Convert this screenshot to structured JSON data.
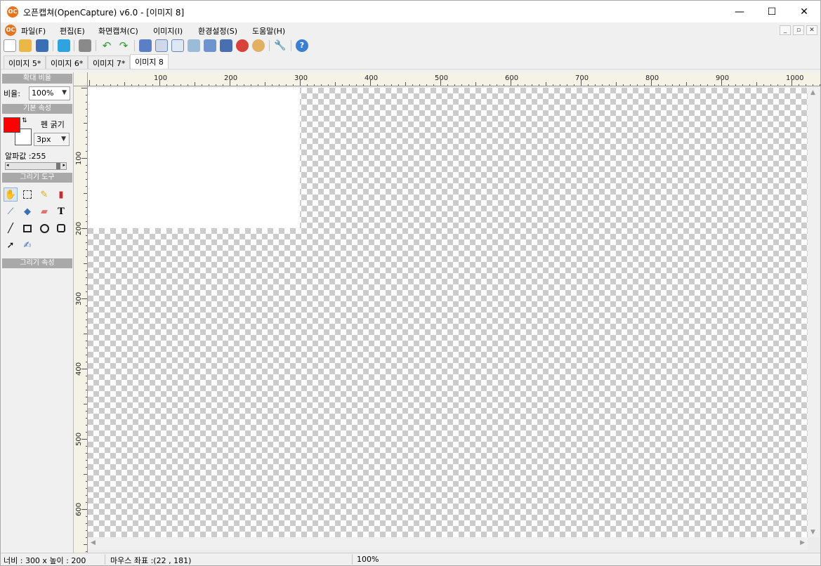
{
  "window": {
    "title": "오픈캡쳐(OpenCapture) v6.0 - [이미지 8]",
    "app_icon_text": "OC",
    "minimize_glyph": "—",
    "maximize_glyph": "☐",
    "close_glyph": "✕"
  },
  "menu": {
    "items": [
      "파일(F)",
      "편집(E)",
      "화면캡쳐(C)",
      "이미지(I)",
      "환경설정(S)",
      "도움말(H)"
    ],
    "mdi_buttons": [
      "_",
      "▫",
      "✕"
    ]
  },
  "toolbar": {
    "icons": [
      "new-icon",
      "open-icon",
      "save-icon",
      "twitter-icon",
      "print-icon",
      "undo-icon",
      "redo-icon",
      "capture-full-icon",
      "capture-window-icon",
      "capture-region-icon",
      "capture-scroll-icon",
      "capture-fixed-icon",
      "effects-icon",
      "color-icon",
      "palette-icon",
      "settings-wrench-icon",
      "help-icon"
    ]
  },
  "tabs": [
    {
      "label": "이미지 5*"
    },
    {
      "label": "이미지 6*"
    },
    {
      "label": "이미지 7*"
    },
    {
      "label": "이미지 8",
      "active": true
    }
  ],
  "left_panel": {
    "zoom_header": "확대 비율",
    "zoom_label": "비율:",
    "zoom_value": "100%",
    "basic_header": "기본 속성",
    "pen_label": "펜 굵기",
    "pen_value": "3px",
    "alpha_label": "알파값 :255",
    "alpha_value": 255,
    "foreground_color": "#ff0000",
    "background_color": "#ffffff",
    "tools_header": "그리기 도구",
    "tools": [
      "hand-icon",
      "select-rect-icon",
      "pencil-icon",
      "marker-icon",
      "eyedropper-icon",
      "fill-bucket-icon",
      "eraser-icon",
      "text-icon",
      "line-icon",
      "rectangle-icon",
      "ellipse-icon",
      "rounded-rect-icon",
      "arrow-icon",
      "note-icon"
    ],
    "active_tool": "hand-icon",
    "props_header": "그리기 속성"
  },
  "rulers": {
    "h_labels": [
      "100",
      "200",
      "300",
      "400",
      "500",
      "600",
      "700",
      "800",
      "900",
      "1000"
    ],
    "v_labels": [
      "100",
      "200",
      "300",
      "400",
      "500",
      "600"
    ]
  },
  "status": {
    "size": "너비 : 300 x 높이 : 200",
    "mouse": "마우스 좌표 :(22 ,  181)",
    "zoom": "100%"
  }
}
